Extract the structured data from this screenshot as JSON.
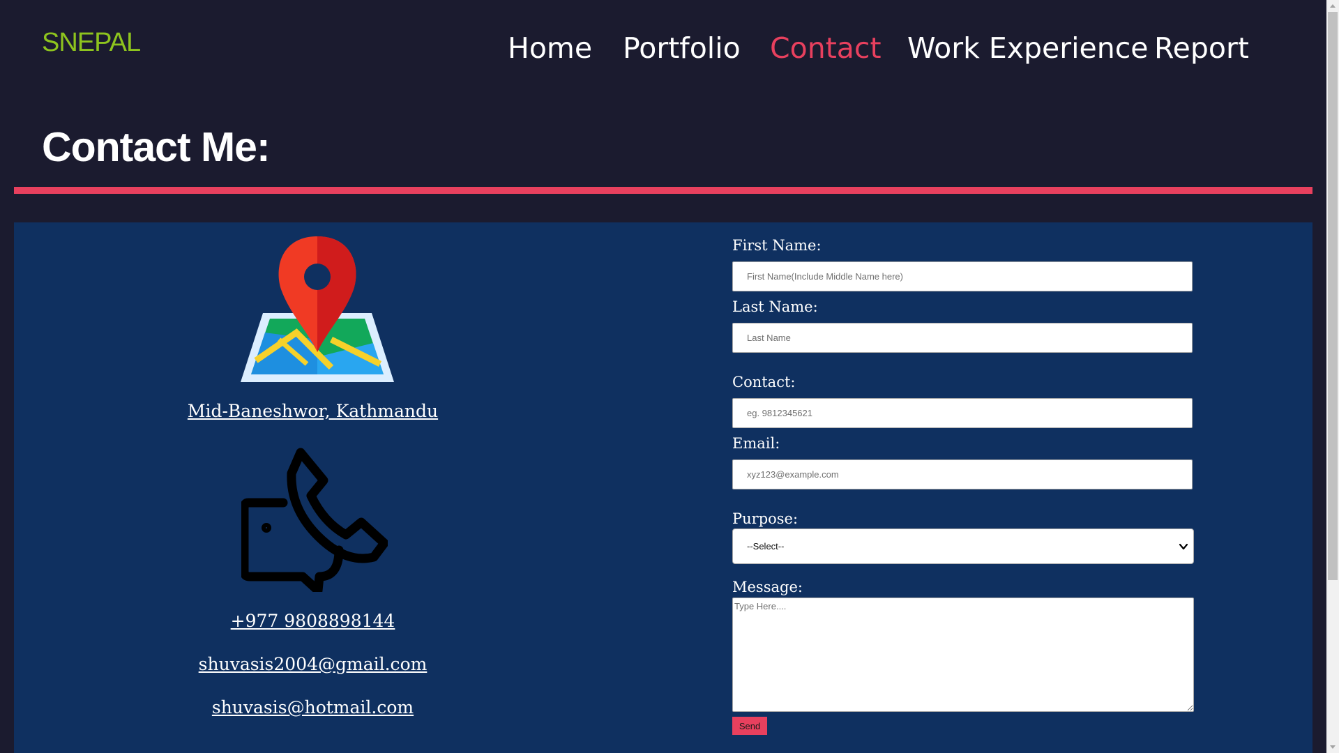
{
  "brand": {
    "logo": "SNEPAL"
  },
  "nav": {
    "items": [
      {
        "label": "Home",
        "active": false
      },
      {
        "label": "Portfolio",
        "active": false
      },
      {
        "label": "Contact",
        "active": true
      },
      {
        "label": "Work Experience",
        "active": false
      },
      {
        "label": "Report",
        "active": false
      }
    ]
  },
  "page": {
    "title": "Contact Me:"
  },
  "contact_info": {
    "address": "Mid-Baneshwor, Kathmandu",
    "phone": "+977 9808898144",
    "emails": [
      "shuvasis2004@gmail.com",
      "shuvasis@hotmail.com"
    ],
    "icons": [
      "map-pin-icon",
      "telephone-icon"
    ]
  },
  "form": {
    "first_name": {
      "label": "First Name:",
      "placeholder": "First Name(Include Middle Name here)",
      "value": ""
    },
    "last_name": {
      "label": "Last Name:",
      "placeholder": "Last Name",
      "value": ""
    },
    "contact": {
      "label": "Contact:",
      "placeholder": "eg. 9812345621",
      "value": ""
    },
    "email": {
      "label": "Email:",
      "placeholder": "xyz123@example.com",
      "value": ""
    },
    "purpose": {
      "label": "Purpose:",
      "selected": "--Select--",
      "options": [
        "--Select--"
      ]
    },
    "message": {
      "label": "Message:",
      "placeholder": "Type Here....",
      "value": ""
    },
    "submit": {
      "label": "Send"
    }
  },
  "colors": {
    "background": "#1b1b2f",
    "panel": "#0f3060",
    "accent": "#e8405e",
    "logo": "#8ec41e",
    "text": "#ffffff"
  }
}
